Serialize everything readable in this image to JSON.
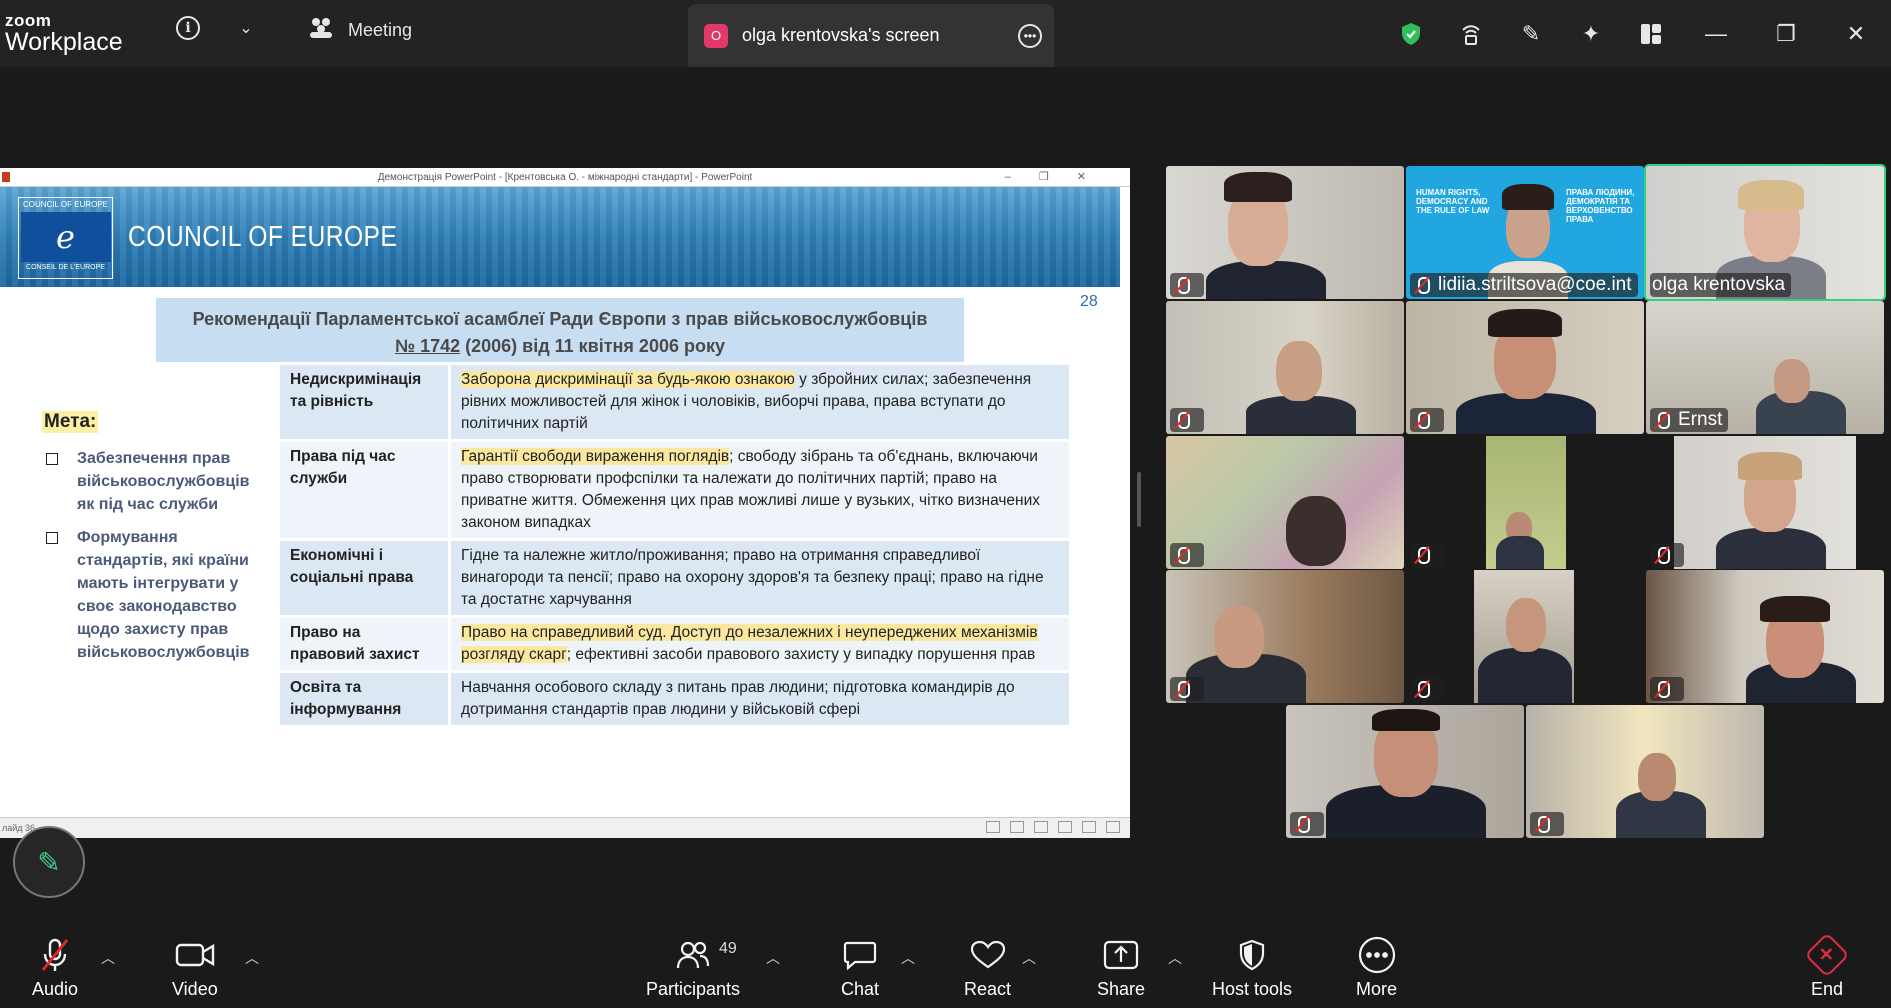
{
  "app": {
    "brand_top": "zoom",
    "brand_bottom": "Workplace"
  },
  "topbar": {
    "meeting_label": "Meeting",
    "screen_tab_initial": "O",
    "screen_tab_label": "olga krentovska's screen"
  },
  "powerpoint": {
    "window_title": "Демонстрація PowerPoint - [Крентовська О. - міжнародні стандарти] - PowerPoint",
    "status_text": "лайд 36"
  },
  "slide": {
    "org_top": "COUNCIL OF EUROPE",
    "org_bottom": "CONSEIL DE L'EUROPE",
    "org_name": "COUNCIL OF EUROPE",
    "number": "28",
    "heading_line1": "Рекомендації Парламентської асамблеї Ради Європи з прав військовослужбовців",
    "heading_ref": "№ 1742",
    "heading_line2_rest": " (2006) від 11 квітня 2006 року",
    "goal_title": "Мета:",
    "goals": [
      "Забезпечення прав військовослужбовців як під час служби",
      "Формування стандартів, які країни мають інтегрувати у своє законодавство щодо захисту прав військовослужбовців"
    ],
    "rows": [
      {
        "key": "Недискримінація та рівність",
        "hl": "Заборона дискримінації за будь-якою ознакою",
        "text": " у збройних силах; забезпечення рівних можливостей для жінок і чоловіків, виборчі права, права вступати до політичних партій"
      },
      {
        "key": "Права під час служби",
        "hl": "Гарантії свободи вираження поглядів",
        "text": "; свободу зібрань та об'єднань, включаючи право створювати профспілки та належати до політичних партій; право на приватне життя. Обмеження цих прав можливі лише у вузьких, чітко визначених законом випадках"
      },
      {
        "key": "Економічні і соціальні права",
        "hl": "",
        "text": "Гідне та належне житло/проживання; право на отримання справедливої винагороди та пенсії; право на охорону здоров'я та безпеку праці; право на гідне та достатнє харчування"
      },
      {
        "key": "Право на правовий захист",
        "hl": "Право на справедливий суд. Доступ до незалежних і неупереджених механізмів розгляду скарг",
        "text": "; ефективні засоби правового захисту у випадку порушення прав"
      },
      {
        "key": "Освіта та інформування",
        "hl": "",
        "text": "Навчання особового складу з питань прав людини; підготовка командирів до дотримання стандартів прав людини у військовій сфері"
      }
    ]
  },
  "gallery": {
    "participants": [
      {
        "name": ""
      },
      {
        "name": "lidiia.striltsova@coe.int"
      },
      {
        "name": "olga krentovska"
      },
      {
        "name": ""
      },
      {
        "name": ""
      },
      {
        "name": "Ernst"
      },
      {
        "name": ""
      },
      {
        "name": ""
      },
      {
        "name": ""
      },
      {
        "name": ""
      },
      {
        "name": ""
      },
      {
        "name": ""
      },
      {
        "name": ""
      },
      {
        "name": ""
      }
    ],
    "slide_tile_text_left": "HUMAN RIGHTS, DEMOCRACY AND THE RULE OF LAW",
    "slide_tile_text_right": "ПРАВА ЛЮДИНИ, ДЕМОКРАТІЯ ТА ВЕРХОВЕНСТВО ПРАВА"
  },
  "toolbar": {
    "audio": "Audio",
    "video": "Video",
    "participants": "Participants",
    "participants_count": "49",
    "chat": "Chat",
    "react": "React",
    "share": "Share",
    "host_tools": "Host tools",
    "more": "More",
    "end": "End"
  },
  "colors": {
    "accent_green": "#30d37d",
    "end_red": "#e02b43",
    "slide_blue": "#2e6eaf"
  }
}
